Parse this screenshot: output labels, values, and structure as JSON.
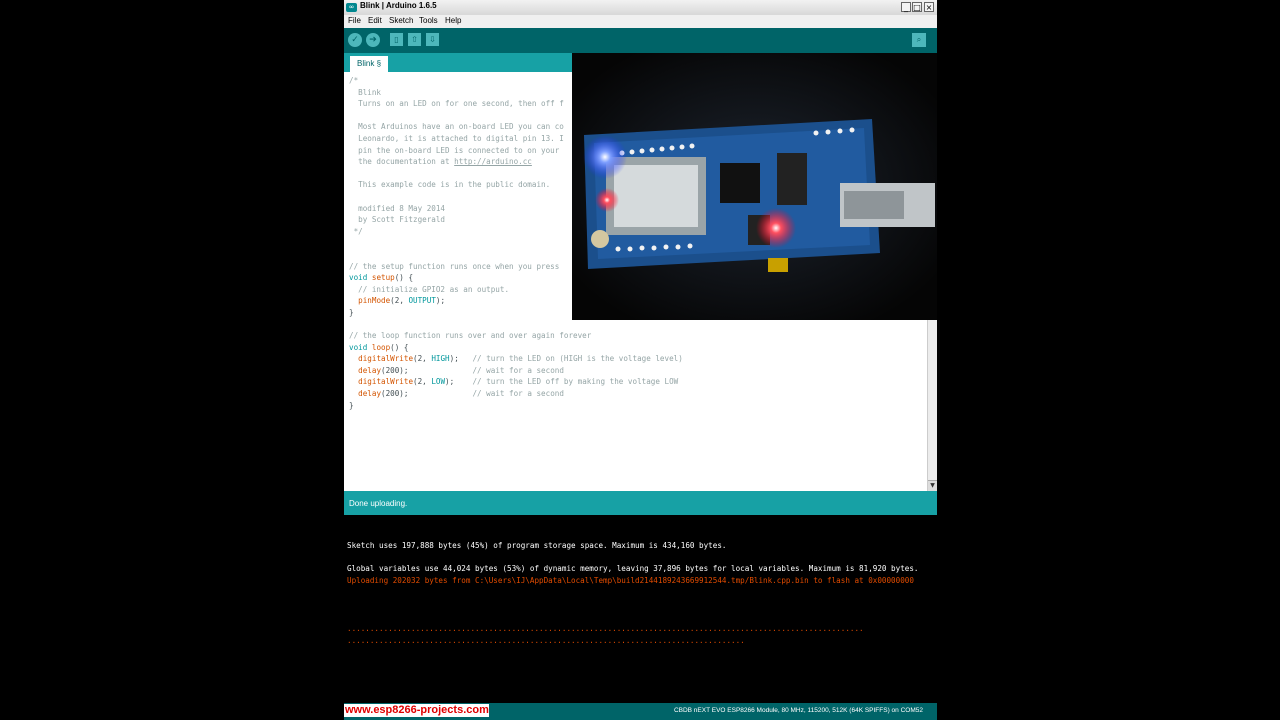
{
  "window": {
    "title": "Blink | Arduino 1.6.5",
    "app_icon": "∞",
    "controls": {
      "minimize": "_",
      "maximize": "□",
      "close": "×"
    }
  },
  "menu": [
    "File",
    "Edit",
    "Sketch",
    "Tools",
    "Help"
  ],
  "toolbar": {
    "verify_icon": "check-icon",
    "upload_icon": "arrow-right-icon",
    "new_icon": "new-file-icon",
    "open_icon": "open-arrow-up-icon",
    "save_icon": "save-arrow-down-icon",
    "serial_monitor_icon": "magnifier-icon",
    "glyphs": {
      "verify": "✓",
      "upload": "➔",
      "new": "▯",
      "open": "⇧",
      "save": "⇩",
      "serial": "⌕"
    }
  },
  "tab": {
    "label": "Blink §"
  },
  "code": {
    "comment_block": [
      "/*",
      "  Blink",
      "  Turns on an LED on for one second, then off f",
      "",
      "  Most Arduinos have an on-board LED you can co",
      "  Leonardo, it is attached to digital pin 13. I",
      "  pin the on-board LED is connected to on your",
      "  the documentation at "
    ],
    "url": "http://arduino.cc",
    "comment_block_2": [
      "",
      "  This example code is in the public domain.",
      "",
      "  modified 8 May 2014",
      "  by Scott Fitzgerald",
      " */",
      "",
      ""
    ],
    "setup_comment": "// the setup function runs once when you press",
    "kw_void": "void",
    "setup_fn": "setup",
    "setup_open": "() {",
    "init_comment": "  // initialize GPIO2 as an output.",
    "pinmode_fn": "pinMode",
    "pinmode_args_a": "(2, ",
    "output_const": "OUTPUT",
    "pinmode_args_b": ");",
    "close_brace": "}",
    "loop_comment": "// the loop function runs over and over again forever",
    "loop_fn": "loop",
    "loop_open": "() {",
    "dw_fn": "digitalWrite",
    "dw_args_a": "(2, ",
    "high_const": "HIGH",
    "dw_high_rest": ");   ",
    "cmt_on": "// turn the LED on (HIGH is the voltage level)",
    "delay_fn": "delay",
    "delay_args": "(200);",
    "delay_pad": "              ",
    "cmt_wait": "// wait for a second",
    "low_const": "LOW",
    "dw_low_rest": ");    ",
    "cmt_off": "// turn the LED off by making the voltage LOW"
  },
  "status": {
    "text": "Done uploading."
  },
  "console": {
    "line1": "Sketch uses 197,888 bytes (45%) of program storage space. Maximum is 434,160 bytes.",
    "line2": "Global variables use 44,024 bytes (53%) of dynamic memory, leaving 37,896 bytes for local variables. Maximum is 81,920 bytes.",
    "line3": "Uploading 202032 bytes from C:\\Users\\IJ\\AppData\\Local\\Temp\\build2144189243669912544.tmp/Blink.cpp.bin to flash at 0x00000000",
    "dots1": ".................................................................................................................",
    "dots2": "......................................................................................."
  },
  "footer": {
    "board": "CBDB nEXT EVO ESP8266 Module, 80 MHz, 115200, 512K (64K SPIFFS) on COM52"
  },
  "watermark": "www.esp8266-projects.com",
  "colors": {
    "teal_dark": "#006468",
    "teal": "#17a1a5",
    "accent_light": "#4db7bb",
    "console_orange": "#e34c00",
    "watermark_red": "#e00000"
  }
}
